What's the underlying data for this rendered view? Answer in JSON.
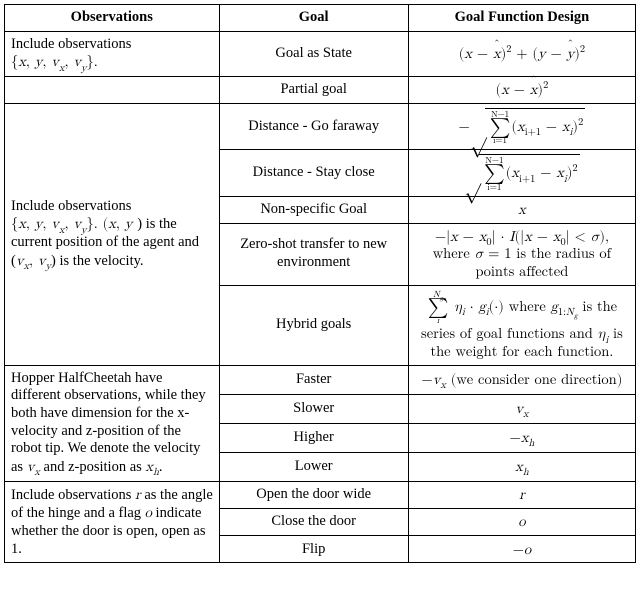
{
  "chart_data": {
    "type": "table",
    "title": "",
    "columns": [
      "Observations",
      "Goal",
      "Goal Function Design"
    ],
    "rows": [
      {
        "observations": "Include observations {x, y, v_x, v_y}.",
        "goal": "Goal as State",
        "goal_function": "(x − x̂)^2 + (y − ŷ)^2"
      },
      {
        "observations": "",
        "goal": "Partial goal",
        "goal_function": "(x − x̂)^2"
      },
      {
        "observations": "Include observations {x, y, v_x, v_y}. (x, y) is the current position of the agent and (v_x, v_y) is the velocity.",
        "goal": "Distance - Go faraway",
        "goal_function": "−√( Σ_{i=1}^{N−1} (x_{i+1} − x_i)^2 )"
      },
      {
        "observations": "",
        "goal": "Distance - Stay close",
        "goal_function": "√( Σ_{i=1}^{N−1} (x_{i+1} − x_i)^2 )"
      },
      {
        "observations": "",
        "goal": "Non-specific Goal",
        "goal_function": "x"
      },
      {
        "observations": "",
        "goal": "Zero-shot transfer to new environment",
        "goal_function": "−|x − x_0| · I(|x − x_0| < σ), where σ = 1 is the radius of points affected"
      },
      {
        "observations": "",
        "goal": "Hybrid goals",
        "goal_function": "Σ_{i}^{N_g} η_i · g_i(·) where g_{1:N_g} is the series of goal functions and η_i is the weight for each function."
      },
      {
        "observations": "Hopper HalfCheetah have different observations, while they both have dimension for the x-velocity and z-position of the robot tip. We denote the velocity as v_x and z-position as x_h.",
        "goal": "Faster",
        "goal_function": "−v_x (we consider one direction)"
      },
      {
        "observations": "",
        "goal": "Slower",
        "goal_function": "v_x"
      },
      {
        "observations": "",
        "goal": "Higher",
        "goal_function": "−x_h"
      },
      {
        "observations": "",
        "goal": "Lower",
        "goal_function": "x_h"
      },
      {
        "observations": "Include observations r as the angle of the hinge and a flag o indicate whether the door is open, open as 1.",
        "goal": "Open the door wide",
        "goal_function": "r"
      },
      {
        "observations": "",
        "goal": "Close the door",
        "goal_function": "o"
      },
      {
        "observations": "",
        "goal": "Flip",
        "goal_function": "−o"
      }
    ]
  },
  "headers": {
    "obs": "Observations",
    "goal": "Goal",
    "func": "Goal Function Design"
  },
  "row1": {
    "obs_text_1": "Include observations",
    "obs_text_2a": "{",
    "obs_text_2b": "}.",
    "goal": "Goal as State"
  },
  "row2": {
    "goal": "Partial goal"
  },
  "group2": {
    "obs_1": "Include observations",
    "obs_2a": "{",
    "obs_2b": "}. (",
    "obs_2c": ") is the current position of the agent and (",
    "obs_2d": ") is the velocity."
  },
  "row3": {
    "goal": "Distance - Go faraway"
  },
  "row4": {
    "goal": "Distance - Stay close"
  },
  "row5": {
    "goal": "Non-specific Goal"
  },
  "row6": {
    "goal_a": "Zero-shot transfer to new",
    "goal_b": "environment",
    "note_a": "where ",
    "note_b": " is the radius of points affected"
  },
  "row7": {
    "goal": "Hybrid goals",
    "note_a": " where ",
    "note_b": " is the series of goal functions and ",
    "note_c": " is the weight for each function."
  },
  "group3": {
    "obs_1": "Hopper HalfCheetah have different observations, while they both have dimension for the x-velocity and z-position of the robot tip. We denote the velocity as ",
    "obs_2": " and z-position as ",
    "obs_3": "."
  },
  "row8": {
    "goal": "Faster",
    "note": " (we consider one direction)"
  },
  "row9": {
    "goal": "Slower"
  },
  "row10": {
    "goal": "Higher"
  },
  "row11": {
    "goal": "Lower"
  },
  "group4": {
    "obs_1": "Include observations ",
    "obs_2": " as the angle of the hinge and a flag ",
    "obs_3": " indicate whether the door is open, open as 1."
  },
  "row12": {
    "goal": "Open the door wide"
  },
  "row13": {
    "goal": "Close the door"
  },
  "row14": {
    "goal": "Flip"
  },
  "sym": {
    "x": "x",
    "y": "y",
    "vx_a": "v",
    "vx_b": "x",
    "vy_a": "v",
    "vy_b": "y",
    "N1": "N−1",
    "i1": "i=1",
    "xi1a": "x",
    "xi1b": "i+1",
    "xi_a": "x",
    "xi_b": "i",
    "sigma": "σ",
    "eq1": " = 1",
    "Ng": "N",
    "g": "g",
    "eta": "η",
    "i": "i",
    "xh_a": "x",
    "xh_b": "h",
    "r": "r",
    "o": "o",
    "x0_b": "0",
    "dot": "·",
    "I": "I",
    "lt": "<",
    "minus": "−",
    "comma": ", "
  }
}
